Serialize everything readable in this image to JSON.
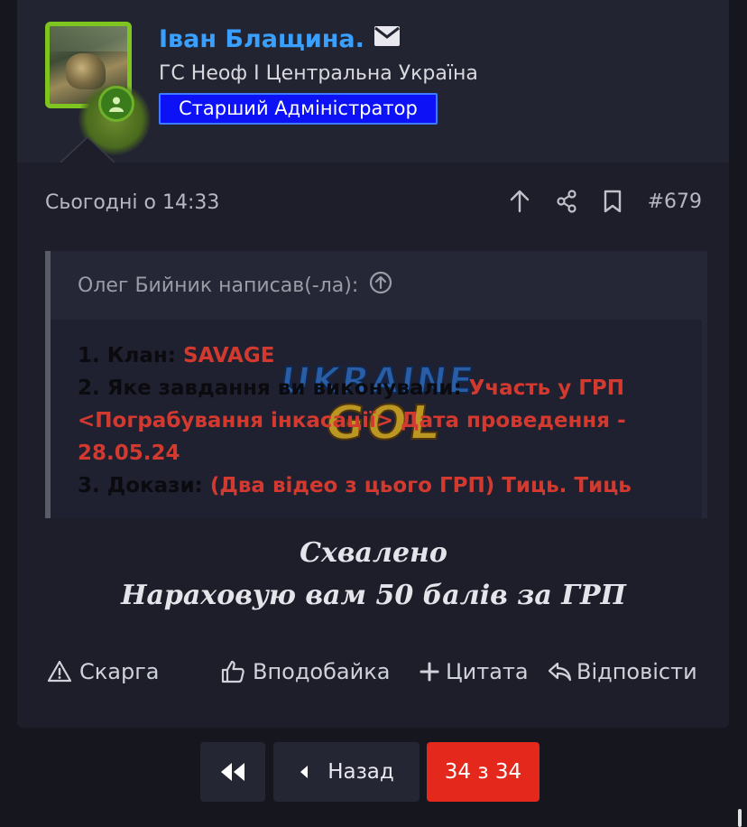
{
  "post": {
    "username": "Іван Блащина.",
    "user_title": "ГС Неоф І Центральна Україна",
    "user_rank": "Старший Адміністратор",
    "date": "Сьогодні о 14:33",
    "post_number": "#679"
  },
  "quote": {
    "author": "Олег Бийник написав(-ла):",
    "line1_label": "1. Клан: ",
    "line1_value": "SAVAGE",
    "line2_label": "2. Яке завдання ви виконували: ",
    "line2_value_a": "Участь у ГРП",
    "line2_value_b": "<Пограбування інкасації> Дата проведення -",
    "line2_value_c": "28.05.24",
    "line3_label": "3. Докази: ",
    "line3_value_a": "(Два відео з цього ГРП) ",
    "line3_link1": "Тиць.",
    "line3_link2": "Тиць",
    "watermark_top": "UKRAINE",
    "watermark_bottom": "GOL"
  },
  "message": {
    "line1": "Схвалено",
    "line2": "Нараховую вам 50 балів за ГРП"
  },
  "actions": {
    "report": "Скарга",
    "like": "Вподобайка",
    "quote": "Цитата",
    "reply": "Відповісти"
  },
  "pagination": {
    "prev_label": "Назад",
    "current": "34 з 34"
  },
  "colors": {
    "username": "#3aa0ff",
    "rank_bg": "#0c12f5",
    "avatar_border": "#7ec520",
    "quote_value": "#d33a2f",
    "current_page": "#e4281c"
  }
}
